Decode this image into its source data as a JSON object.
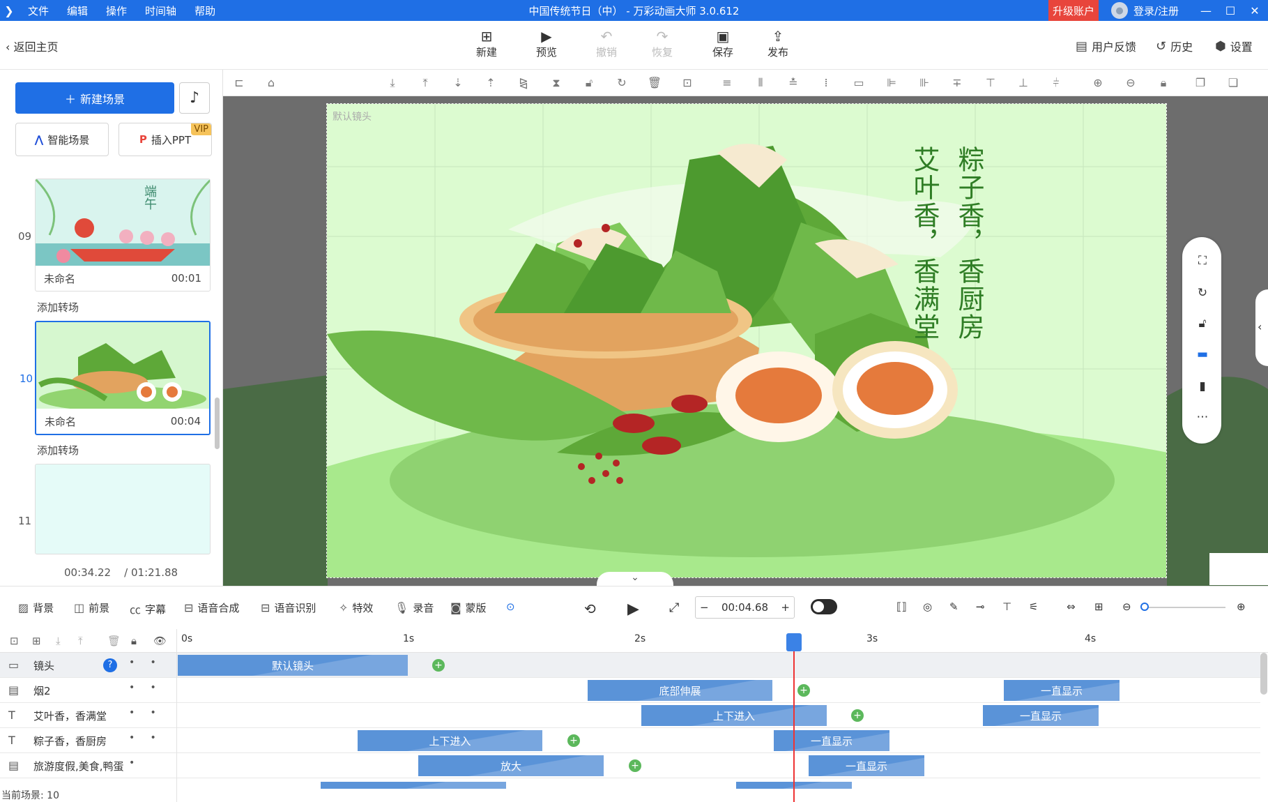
{
  "app": {
    "title": "中国传统节日（中） - 万彩动画大师 3.0.612",
    "menu": [
      "文件",
      "编辑",
      "操作",
      "时间轴",
      "帮助"
    ],
    "upgrade": "升级账户",
    "login": "登录/注册",
    "window_controls": [
      "minimize-icon",
      "maximize-icon",
      "close-icon"
    ]
  },
  "toolbar": {
    "back": "返回主页",
    "buttons": [
      {
        "label": "新建",
        "icon": "plus-square-icon",
        "enabled": true
      },
      {
        "label": "预览",
        "icon": "play-icon",
        "enabled": true
      },
      {
        "label": "撤销",
        "icon": "undo-icon",
        "enabled": false
      },
      {
        "label": "恢复",
        "icon": "redo-icon",
        "enabled": false
      },
      {
        "label": "保存",
        "icon": "save-icon",
        "enabled": true
      },
      {
        "label": "发布",
        "icon": "publish-icon",
        "enabled": true
      }
    ],
    "right": [
      {
        "label": "用户反馈",
        "icon": "feedback-icon"
      },
      {
        "label": "历史",
        "icon": "history-icon"
      },
      {
        "label": "设置",
        "icon": "settings-icon"
      }
    ]
  },
  "left_panel": {
    "new_scene": "新建场景",
    "smart_scene": "智能场景",
    "insert_ppt": "插入PPT",
    "vip": "VIP",
    "scenes": [
      {
        "num": "09",
        "name": "未命名",
        "duration": "00:01",
        "thumb_text": "端午",
        "selected": false
      },
      {
        "num": "10",
        "name": "未命名",
        "duration": "00:04",
        "selected": true
      },
      {
        "num": "11",
        "name": "",
        "duration": "",
        "selected": false
      }
    ],
    "add_transition": "添加转场",
    "current_time": "00:34.22",
    "total_time": "/ 01:21.88"
  },
  "canvas": {
    "camera_label": "默认镜头",
    "poem_right": "粽子香，香厨房",
    "poem_left": "艾叶香，香满堂",
    "colors": {
      "bg": "#dcfbd0",
      "leaf": "#5ea838",
      "steamer": "#e2a35f",
      "egg_yolk": "#e57a3c"
    }
  },
  "bottom_tools": {
    "items": [
      {
        "label": "背景",
        "icon": "background-icon"
      },
      {
        "label": "前景",
        "icon": "foreground-icon"
      },
      {
        "label": "字幕",
        "icon": "subtitle-icon"
      },
      {
        "label": "语音合成",
        "icon": "tts-icon"
      },
      {
        "label": "语音识别",
        "icon": "speech-recognition-icon"
      },
      {
        "label": "特效",
        "icon": "effects-icon"
      },
      {
        "label": "录音",
        "icon": "microphone-icon"
      },
      {
        "label": "蒙版",
        "icon": "mask-icon"
      }
    ],
    "time_value": "00:04.68"
  },
  "timeline": {
    "ticks": [
      "0s",
      "1s",
      "2s",
      "3s",
      "4s"
    ],
    "tracks": [
      {
        "name": "镜头",
        "icon": "camera-icon",
        "clips": [
          {
            "label": "默认镜头"
          }
        ]
      },
      {
        "name": "烟2",
        "icon": "image-icon",
        "clips": [
          {
            "label": "底部伸展"
          },
          {
            "label": "一直显示"
          }
        ]
      },
      {
        "name": "艾叶香，香满堂",
        "icon": "text-icon",
        "clips": [
          {
            "label": "上下进入"
          },
          {
            "label": "一直显示"
          }
        ]
      },
      {
        "name": "粽子香，香厨房",
        "icon": "text-icon",
        "clips": [
          {
            "label": "上下进入"
          },
          {
            "label": "一直显示"
          }
        ]
      },
      {
        "name": "旅游度假,美食,鸭蛋",
        "icon": "image-icon",
        "clips": [
          {
            "label": "放大"
          },
          {
            "label": "一直显示"
          }
        ]
      }
    ],
    "status": "当前场景: 10"
  }
}
